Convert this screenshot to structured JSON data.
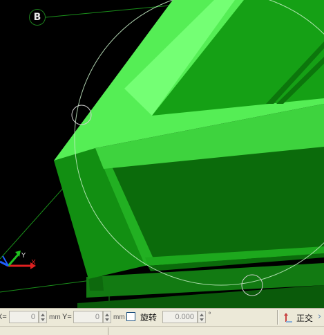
{
  "viewport": {
    "axis_marker": "B",
    "ucs_icon": {
      "y_label": "Y",
      "x_label": "X",
      "colors": {
        "x_axis": "#e02020",
        "y_axis": "#20c020",
        "z_axis": "#2060ff"
      }
    },
    "colors": {
      "background": "#000000",
      "top_face": "#55ee55",
      "front_face": "#0b6b0b",
      "side_face": "#1da81d",
      "guide_lines": "#1a8f1a"
    }
  },
  "status_bar": {
    "x_label": "X=",
    "x_value": "0",
    "x_unit": "mm",
    "y_label": "Y=",
    "y_value": "0",
    "y_unit": "mm",
    "rotate_label": "旋转",
    "rotate_checked": false,
    "angle_value": "0.000",
    "angle_unit": "°",
    "ortho_label": "正交",
    "icons": [
      "ortho-icon",
      "more-icon"
    ]
  }
}
